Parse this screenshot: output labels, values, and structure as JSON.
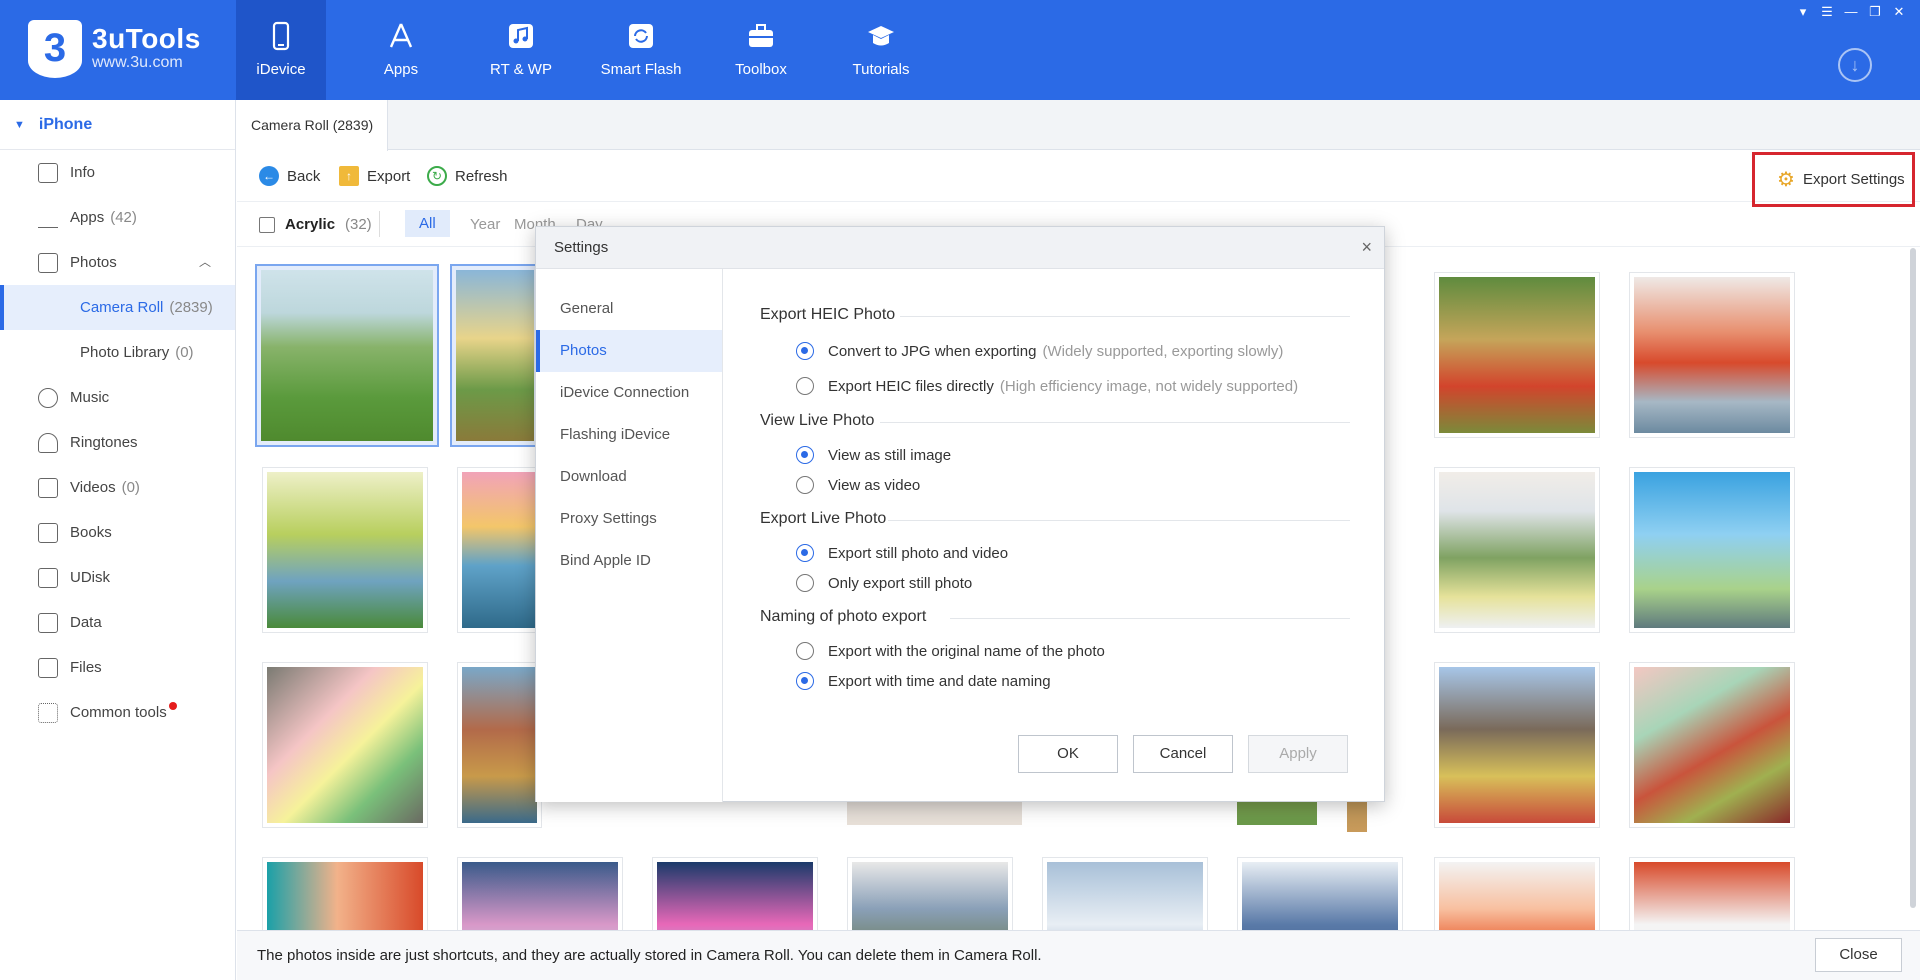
{
  "app": {
    "name": "3uTools",
    "url": "www.3u.com"
  },
  "nav": [
    {
      "label": "iDevice",
      "icon": "phone-icon"
    },
    {
      "label": "Apps",
      "icon": "app-store-icon"
    },
    {
      "label": "RT & WP",
      "icon": "music-note-icon"
    },
    {
      "label": "Smart Flash",
      "icon": "refresh-box-icon"
    },
    {
      "label": "Toolbox",
      "icon": "toolbox-icon"
    },
    {
      "label": "Tutorials",
      "icon": "graduation-cap-icon"
    }
  ],
  "sidebar": {
    "device": "iPhone",
    "items": [
      {
        "label": "Info",
        "count": ""
      },
      {
        "label": "Apps",
        "count": "(42)"
      },
      {
        "label": "Photos",
        "count": ""
      },
      {
        "label": "Camera Roll",
        "count": "(2839)"
      },
      {
        "label": "Photo Library",
        "count": "(0)"
      },
      {
        "label": "Music",
        "count": ""
      },
      {
        "label": "Ringtones",
        "count": ""
      },
      {
        "label": "Videos",
        "count": "(0)"
      },
      {
        "label": "Books",
        "count": ""
      },
      {
        "label": "UDisk",
        "count": ""
      },
      {
        "label": "Data",
        "count": ""
      },
      {
        "label": "Files",
        "count": ""
      },
      {
        "label": "Common tools",
        "count": ""
      }
    ]
  },
  "tab": {
    "label": "Camera Roll (2839)"
  },
  "toolbar": {
    "back": "Back",
    "export": "Export",
    "refresh": "Refresh",
    "export_settings": "Export Settings"
  },
  "filter": {
    "album": "Acrylic",
    "count": "(32)",
    "all": "All",
    "year": "Year",
    "month": "Month",
    "day": "Day"
  },
  "bottom": {
    "message": "The photos inside are just shortcuts, and they are actually stored in Camera Roll. You can delete them in Camera Roll.",
    "close": "Close"
  },
  "dialog": {
    "title": "Settings",
    "nav": [
      "General",
      "Photos",
      "iDevice Connection",
      "Flashing iDevice",
      "Download",
      "Proxy Settings",
      "Bind Apple ID"
    ],
    "sections": {
      "heic": "Export HEIC Photo",
      "heic_jpg": "Convert to JPG when exporting",
      "heic_jpg_hint": "(Widely supported, exporting slowly)",
      "heic_direct": "Export HEIC files directly",
      "heic_direct_hint": "(High efficiency image, not widely supported)",
      "view_live": "View Live Photo",
      "view_still": "View as still image",
      "view_video": "View as video",
      "export_live": "Export Live Photo",
      "export_still_video": "Export still photo and video",
      "export_still_only": "Only export still photo",
      "naming": "Naming of photo export",
      "naming_original": "Export with the original name of the photo",
      "naming_time": "Export with time and date naming"
    },
    "buttons": {
      "ok": "OK",
      "cancel": "Cancel",
      "apply": "Apply"
    }
  }
}
